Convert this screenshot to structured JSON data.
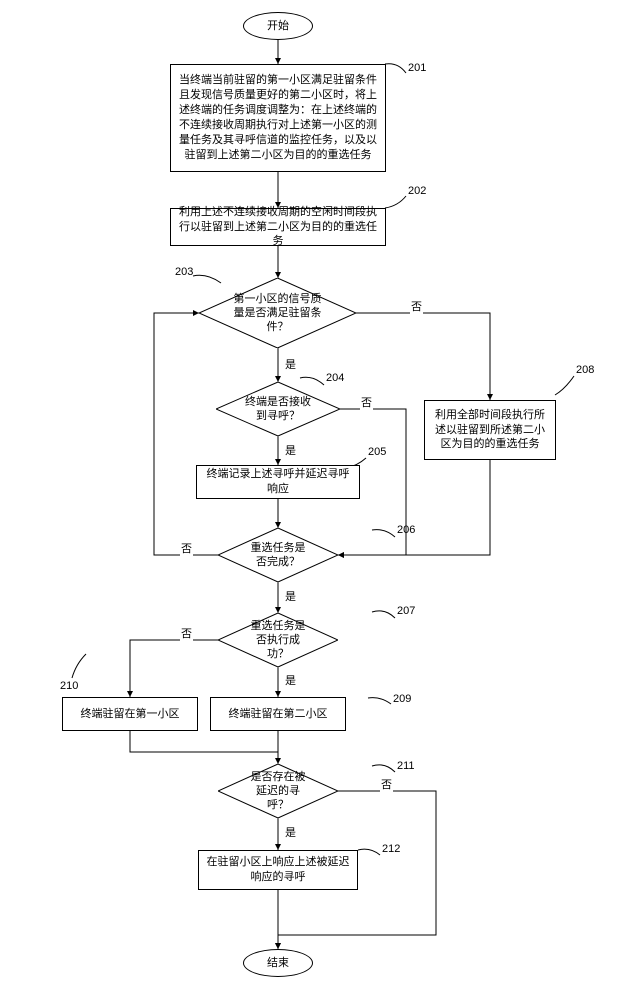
{
  "terminals": {
    "start": "开始",
    "end": "结束"
  },
  "processes": {
    "p201": "当终端当前驻留的第一小区满足驻留条件且发现信号质量更好的第二小区时，将上述终端的任务调度调整为：在上述终端的不连续接收周期执行对上述第一小区的测量任务及其寻呼信道的监控任务，以及以驻留到上述第二小区为目的的重选任务",
    "p202": "利用上述不连续接收周期的空闲时间段执行以驻留到上述第二小区为目的的重选任务",
    "p205": "终端记录上述寻呼并延迟寻呼响应",
    "p208": "利用全部时间段执行所述以驻留到所述第二小区为目的的重选任务",
    "p209": "终端驻留在第二小区",
    "p210": "终端驻留在第一小区",
    "p212": "在驻留小区上响应上述被延迟响应的寻呼"
  },
  "decisions": {
    "d203": "第一小区的信号质量是否满足驻留条件？",
    "d204": "终端是否接收到寻呼？",
    "d206": "重选任务是否完成？",
    "d207": "重选任务是否执行成功？",
    "d211": "是否存在被延迟的寻呼？"
  },
  "refs": {
    "r201": "201",
    "r202": "202",
    "r203": "203",
    "r204": "204",
    "r205": "205",
    "r206": "206",
    "r207": "207",
    "r208": "208",
    "r209": "209",
    "r210": "210",
    "r211": "211",
    "r212": "212"
  },
  "labels": {
    "yes": "是",
    "no": "否"
  }
}
